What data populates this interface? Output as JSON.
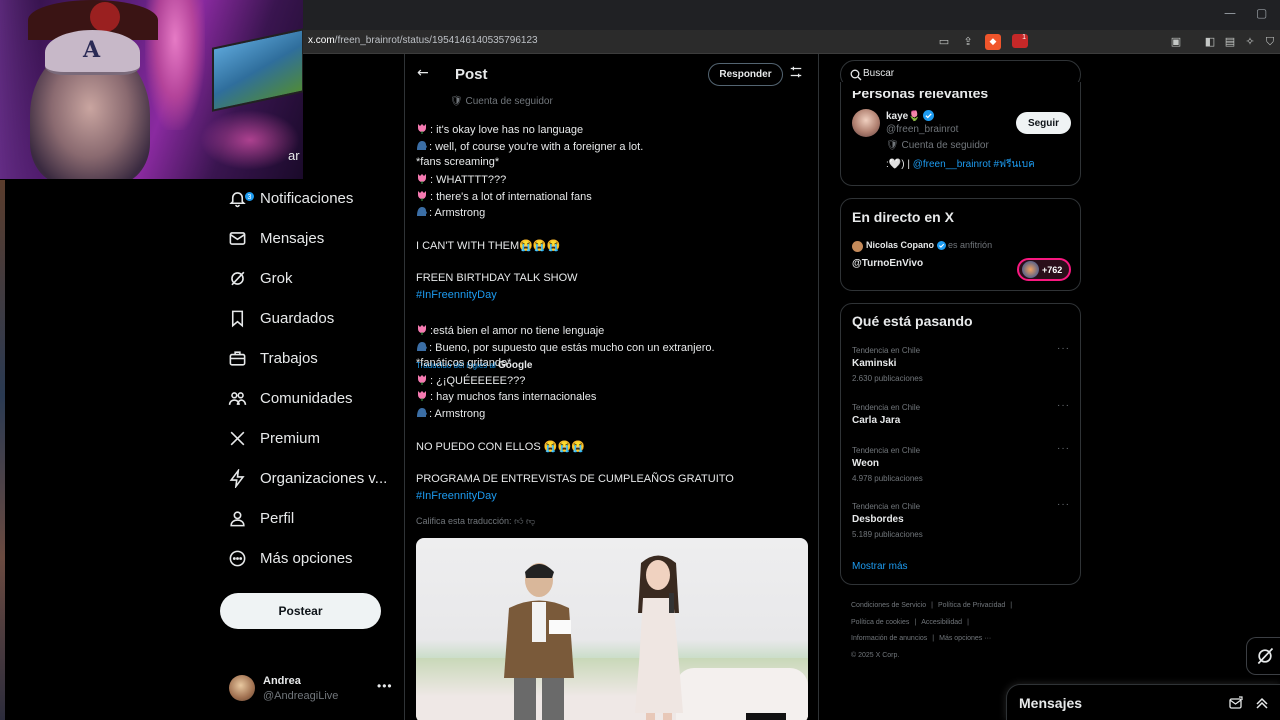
{
  "browser": {
    "url_host": "x.com",
    "url_path": "/freen_brainrot/status/1954146140535796123",
    "shield_badge": "1"
  },
  "webcam": {
    "overlay_text": "ar"
  },
  "nav": {
    "items": [
      {
        "label": "Notificaciones",
        "icon": "bell-icon",
        "badge": "3"
      },
      {
        "label": "Mensajes",
        "icon": "envelope-icon"
      },
      {
        "label": "Grok",
        "icon": "grok-icon"
      },
      {
        "label": "Guardados",
        "icon": "bookmark-icon"
      },
      {
        "label": "Trabajos",
        "icon": "briefcase-icon"
      },
      {
        "label": "Comunidades",
        "icon": "communities-icon"
      },
      {
        "label": "Premium",
        "icon": "x-logo-icon"
      },
      {
        "label": "Organizaciones v...",
        "icon": "lightning-icon"
      },
      {
        "label": "Perfil",
        "icon": "person-icon"
      },
      {
        "label": "Más opciones",
        "icon": "more-circle-icon"
      }
    ],
    "post_button": "Postear",
    "user": {
      "name": "Andrea",
      "handle": "@AndreagiLive",
      "more": "•••"
    }
  },
  "header": {
    "title": "Post",
    "back_icon": "arrow-left-icon",
    "reply_button": "Responder"
  },
  "tweet": {
    "follower_tag": "Cuenta de seguidor",
    "original": [
      ": it's okay love has no language",
      ": well, of course you're with a foreigner a lot.",
      "*fans screaming*",
      ": WHATTTT???",
      ": there's a lot of international fans",
      ": Armstrong"
    ],
    "reaction_en": "I CAN'T WITH THEM😭😭😭",
    "show_en": "FREEN BIRTHDAY TALK SHOW",
    "hashtag": "#InFreennityDay",
    "translated_by": "Traducido del inglés al",
    "translator": "Google",
    "translated": [
      ":está bien el amor no tiene lenguaje",
      ": Bueno, por supuesto que estás mucho con un extranjero.",
      "*fanáticos gritando*",
      ": ¿¡QUÉEEEEE???",
      ": hay muchos fans internacionales",
      ": Armstrong"
    ],
    "reaction_es": "NO PUEDO CON ELLOS 😭😭😭",
    "show_es": "PROGRAMA DE ENTREVISTAS DE CUMPLEAÑOS GRATUITO",
    "rate_translation": "Califica esta traducción:"
  },
  "search": {
    "placeholder": "Buscar"
  },
  "relevant": {
    "title": "Personas relevantes",
    "name": "kaye🌷",
    "handle": "@freen_brainrot",
    "follow_button": "Seguir",
    "tag": "Cuenta de seguidor",
    "bio_prefix": ":🤍) | ",
    "bio_link": "@freen__brainrot #ฟรีนเบค"
  },
  "live": {
    "title": "En directo en X",
    "host": "Nicolas Copano",
    "host_role": "es anfitrión",
    "space": "@TurnoEnVivo",
    "listeners": "+762"
  },
  "trends": {
    "title": "Qué está pasando",
    "items": [
      {
        "category": "Tendencia en Chile",
        "name": "Kaminski",
        "count": "2.630 publicaciones"
      },
      {
        "category": "Tendencia en Chile",
        "name": "Carla Jara",
        "count": ""
      },
      {
        "category": "Tendencia en Chile",
        "name": "Weon",
        "count": "4.978 publicaciones"
      },
      {
        "category": "Tendencia en Chile",
        "name": "Desbordes",
        "count": "5.189 publicaciones"
      }
    ],
    "show_more": "Mostrar más"
  },
  "footer": {
    "links": [
      "Condiciones de Servicio",
      "|",
      "Política de Privacidad",
      "|",
      "Política de cookies",
      "|",
      "Accesibilidad",
      "|",
      "Información de anuncios",
      "|",
      "Más opciones ···"
    ],
    "copyright": "© 2025 X Corp."
  },
  "messages_drawer": {
    "title": "Mensajes"
  },
  "colors": {
    "accent": "#1d9bf0",
    "live": "#f91880",
    "background": "#000000"
  }
}
